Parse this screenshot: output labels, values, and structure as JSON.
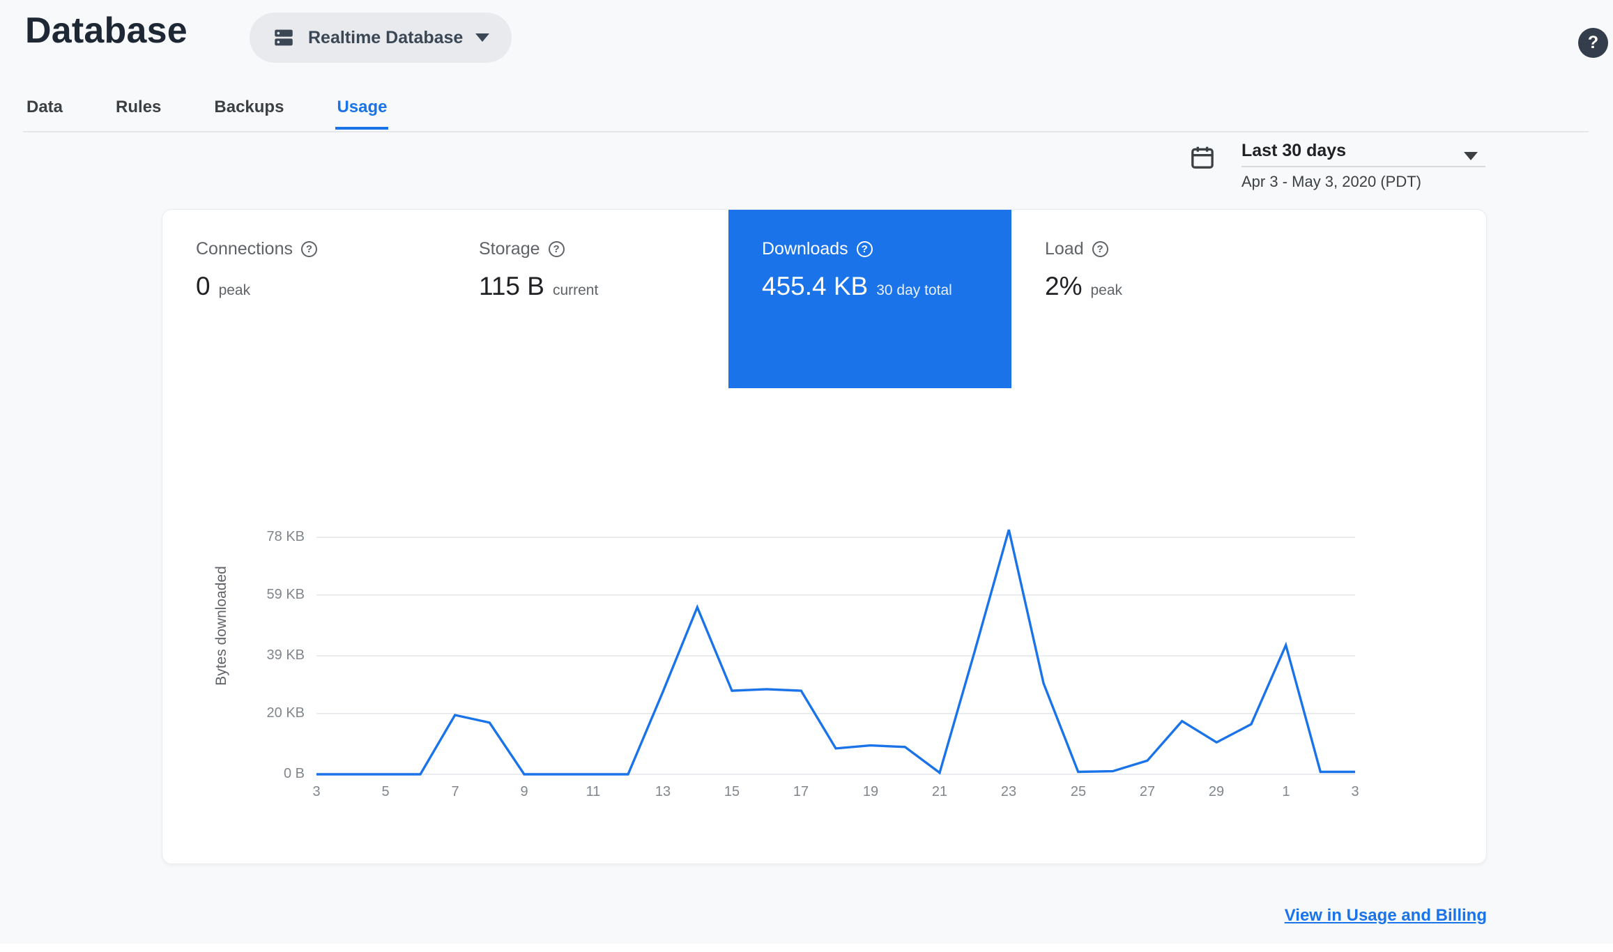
{
  "header": {
    "title": "Database",
    "db_selector_label": "Realtime Database",
    "help_glyph": "?"
  },
  "tabs": [
    {
      "label": "Data",
      "active": false
    },
    {
      "label": "Rules",
      "active": false
    },
    {
      "label": "Backups",
      "active": false
    },
    {
      "label": "Usage",
      "active": true
    }
  ],
  "date_range": {
    "label": "Last 30 days",
    "detail": "Apr 3 - May 3, 2020 (PDT)"
  },
  "metrics": [
    {
      "name": "Connections",
      "value": "0",
      "unit": "peak",
      "selected": false
    },
    {
      "name": "Storage",
      "value": "115 B",
      "unit": "current",
      "selected": false
    },
    {
      "name": "Downloads",
      "value": "455.4 KB",
      "unit": "30 day total",
      "selected": true
    },
    {
      "name": "Load",
      "value": "2%",
      "unit": "peak",
      "selected": false
    }
  ],
  "chart_data": {
    "type": "line",
    "title": "",
    "ylabel": "Bytes downloaded",
    "x_dates": [
      "Apr 3",
      "Apr 4",
      "Apr 5",
      "Apr 6",
      "Apr 7",
      "Apr 8",
      "Apr 9",
      "Apr 10",
      "Apr 11",
      "Apr 12",
      "Apr 13",
      "Apr 14",
      "Apr 15",
      "Apr 16",
      "Apr 17",
      "Apr 18",
      "Apr 19",
      "Apr 20",
      "Apr 21",
      "Apr 22",
      "Apr 23",
      "Apr 24",
      "Apr 25",
      "Apr 26",
      "Apr 27",
      "Apr 28",
      "Apr 29",
      "Apr 30",
      "May 1",
      "May 2",
      "May 3"
    ],
    "values_kb": [
      0,
      0,
      0,
      0,
      19.5,
      17,
      0,
      0,
      0,
      0,
      27,
      55,
      27.5,
      28,
      27.5,
      8.5,
      9.5,
      9,
      0.5,
      40,
      80.5,
      30,
      0.8,
      1,
      4.5,
      17.5,
      10.5,
      16.5,
      42.5,
      0.8,
      0.8
    ],
    "xticks": [
      "3",
      "5",
      "7",
      "9",
      "11",
      "13",
      "15",
      "17",
      "19",
      "21",
      "23",
      "25",
      "27",
      "29",
      "1",
      "3"
    ],
    "yticks": [
      {
        "label": "78 KB",
        "value": 78
      },
      {
        "label": "59 KB",
        "value": 59
      },
      {
        "label": "39 KB",
        "value": 39
      },
      {
        "label": "20 KB",
        "value": 20
      },
      {
        "label": "0 B",
        "value": 0
      }
    ],
    "ylim": [
      0,
      85
    ],
    "grid": true,
    "legend": "none",
    "line_color": "#1a73e8"
  },
  "footer": {
    "link_label": "View in Usage and Billing"
  },
  "icons": {
    "question_mark": "?"
  },
  "colors": {
    "accent": "#1a73e8",
    "selected_tile_bg": "#1a73e8",
    "page_bg": "#f8f9fa",
    "chart_line": "#1a73e8",
    "grid_line": "#e3e6ea"
  }
}
